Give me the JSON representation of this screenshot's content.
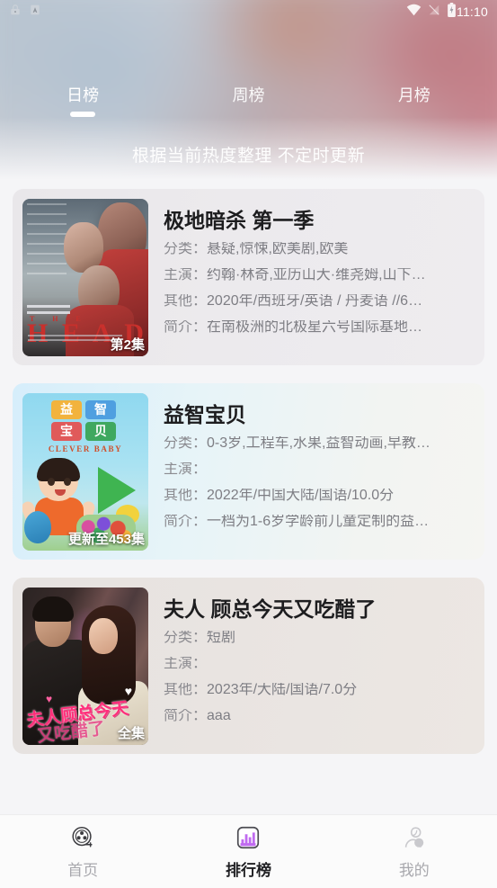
{
  "statusbar": {
    "time": "11:10",
    "icons_left": [
      "lock-icon",
      "adb-icon"
    ],
    "icons_right": [
      "wifi-icon",
      "signal-off-icon",
      "battery-icon"
    ]
  },
  "header": {
    "tabs": [
      {
        "label": "日榜",
        "active": true
      },
      {
        "label": "周榜",
        "active": false
      },
      {
        "label": "月榜",
        "active": false
      }
    ],
    "subtitle": "根据当前热度整理 不定时更新"
  },
  "labels": {
    "category": "分类：",
    "cast": "主演：",
    "other": "其他：",
    "summary": "简介："
  },
  "list": [
    {
      "title": "极地暗杀 第一季",
      "badge": "第2集",
      "poster_text_the": "T  H  E",
      "poster_text_head": "H E A D",
      "category": "悬疑,惊悚,欧美剧,欧美",
      "cast": "约翰·林奇,亚历山大·维尧姆,山下…",
      "other": "2020年/西班牙/英语 / 丹麦语 //6…",
      "summary": "在南极洲的北极星六号国际基地…"
    },
    {
      "title": "益智宝贝",
      "badge": "更新至453集",
      "poster_blocks": [
        "益",
        "智",
        "宝",
        "贝"
      ],
      "poster_sub": "CLEVER BABY",
      "category": "0-3岁,工程车,水果,益智动画,早教…",
      "cast": "",
      "other": "2022年/中国大陆/国语/10.0分",
      "summary": "一档为1-6岁学龄前儿童定制的益…"
    },
    {
      "title": "夫人 顾总今天又吃醋了",
      "badge": "全集",
      "poster_title": "夫人顾总今天",
      "poster_title2": "又吃醋了",
      "category": "短剧",
      "cast": "",
      "other": "2023年/大陆/国语/7.0分",
      "summary": "aaa"
    }
  ],
  "bottomnav": [
    {
      "label": "首页",
      "icon": "film-reel-icon",
      "active": false
    },
    {
      "label": "排行榜",
      "icon": "bar-chart-icon",
      "active": true
    },
    {
      "label": "我的",
      "icon": "user-profile-icon",
      "active": false
    }
  ],
  "colors": {
    "accent": "#c06bf0",
    "nav_active_text": "#1f1f22",
    "nav_inactive_text": "#a8a8ad",
    "card1_bg": "#eceaed",
    "card2_bg": "#d6eefb",
    "card3_bg": "#e9e4e1"
  }
}
